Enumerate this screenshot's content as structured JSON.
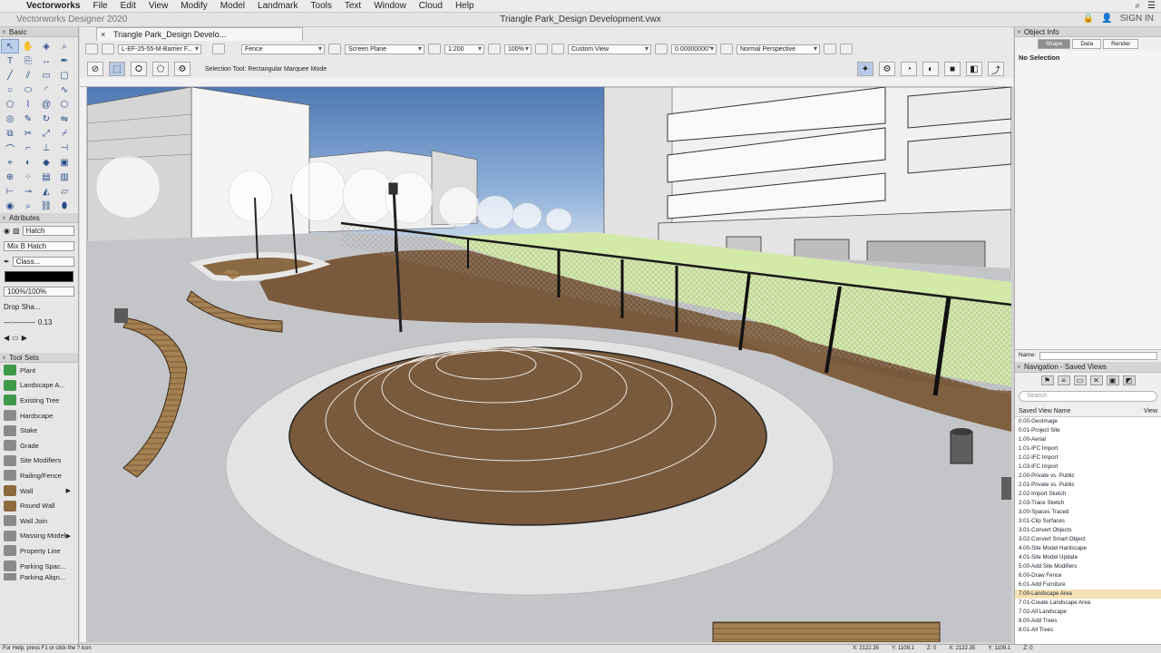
{
  "menubar": {
    "app": "Vectorworks",
    "items": [
      "File",
      "Edit",
      "View",
      "Modify",
      "Model",
      "Landmark",
      "Tools",
      "Text",
      "Window",
      "Cloud",
      "Help"
    ],
    "signin": "SIGN IN"
  },
  "window": {
    "app_version": "Vectorworks Designer 2020",
    "doc_title": "Triangle Park_Design Development.vwx"
  },
  "doc_tab": {
    "label": "Triangle Park_Design Develo..."
  },
  "view_bar": {
    "layer": "L-EF-25-55-M-Barrier F...",
    "class": "Fence",
    "plane": "Screen Plane",
    "scale": "1:200",
    "zoom": "100%",
    "view": "Custom View",
    "rotation": "0.00000000°",
    "projection": "Normal Perspective"
  },
  "mode_bar": {
    "message": "Selection Tool: Rectangular Marquee Mode"
  },
  "palettes": {
    "basic": "Basic",
    "attributes": "Attributes",
    "tool_sets": "Tool Sets"
  },
  "attributes": {
    "fill_type": "Hatch",
    "fill_pattern": "Mix B Hatch",
    "pen_style": "Class...",
    "opacity": "100%/100%",
    "drop_shadow": "Drop Sha...",
    "line_weight": "0.13"
  },
  "tool_sets": [
    {
      "label": "Plant",
      "icon": "plant-icon"
    },
    {
      "label": "Landscape A...",
      "icon": "landscape-area-icon"
    },
    {
      "label": "Existing Tree",
      "icon": "existing-tree-icon"
    },
    {
      "label": "Hardscape",
      "icon": "hardscape-icon"
    },
    {
      "label": "Stake",
      "icon": "stake-icon"
    },
    {
      "label": "Grade",
      "icon": "grade-icon"
    },
    {
      "label": "Site Modifiers",
      "icon": "site-modifiers-icon"
    },
    {
      "label": "Railing/Fence",
      "icon": "railing-fence-icon"
    },
    {
      "label": "Wall",
      "icon": "wall-icon"
    },
    {
      "label": "Round Wall",
      "icon": "round-wall-icon"
    },
    {
      "label": "Wall Join",
      "icon": "wall-join-icon"
    },
    {
      "label": "Massing Model",
      "icon": "massing-model-icon"
    },
    {
      "label": "Property Line",
      "icon": "property-line-icon"
    },
    {
      "label": "Parking Spac...",
      "icon": "parking-space-icon"
    },
    {
      "label": "Parking Align...",
      "icon": "parking-align-icon"
    }
  ],
  "object_info": {
    "title": "Object Info",
    "tabs": [
      "Shape",
      "Data",
      "Render"
    ],
    "selection": "No Selection",
    "name_label": "Name:"
  },
  "navigation": {
    "title": "Navigation - Saved Views",
    "search_placeholder": "Search",
    "col_name": "Saved View Name",
    "col_view": "View",
    "items": [
      "0.00-GeoImage",
      "0.01-Project Site",
      "1.00-Aerial",
      "1.01-IFC Import",
      "1.02-IFC Import",
      "1.03-IFC Import",
      "2.00-Private vs. Public",
      "2.01-Private vs. Public",
      "2.02-Import Sketch",
      "2.03-Trace Sketch",
      "3.00-Spaces Traced",
      "3.01-Clip Surfaces",
      "3.01-Convert Objects",
      "3.02-Convert Smart Object",
      "4.00-Site Model Hardscape",
      "4.01-Site Model Update",
      "5.00-Add Site Modifiers",
      "6.00-Draw Fence",
      "6.01-Add Furniture",
      "7.00-Landscape Area",
      "7.01-Create Landscape Area",
      "7.02-All Landscape",
      "8.00-Add Trees",
      "8.01-All Trees"
    ],
    "selected_index": 19
  },
  "status": {
    "help": "For Help, press F1 or click the ? icon",
    "x": "X: 2122.35",
    "y": "Y: 1109.1",
    "z": "Z: 0",
    "x2": "X: 2122.35",
    "y2": "Y: 1109.1",
    "z2": "Z: 0"
  },
  "colors": {
    "sky": "#6f94c4",
    "ground": "#c7c7c9",
    "planting": "#7a5a3c",
    "lawn": "#d6ebb0",
    "accent": "#3b6fc4"
  }
}
